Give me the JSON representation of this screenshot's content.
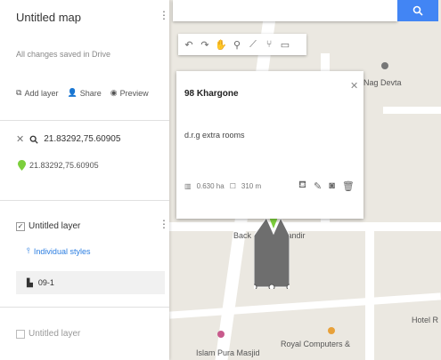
{
  "sidebar": {
    "map_title": "Untitled map",
    "save_status": "All changes saved in Drive",
    "actions": {
      "add_layer": "Add layer",
      "share": "Share",
      "preview": "Preview"
    },
    "search_query": "21.83292,75.60905",
    "location_label": "21.83292,75.60905",
    "layer_name": "Untitled layer",
    "layer_style": "Individual styles",
    "feature_name": "09-1",
    "layer2_name": "Untitled layer"
  },
  "toolbar": {
    "icons": [
      "undo-icon",
      "redo-icon",
      "hand-icon",
      "marker-icon",
      "line-icon",
      "route-icon",
      "ruler-icon"
    ]
  },
  "card": {
    "title": "98 Khargone",
    "description": "d.r.g extra rooms",
    "area": "0.630 ha",
    "perimeter": "310 m"
  },
  "map": {
    "labels": {
      "nag_devta": "Nag Devta",
      "back_mandir": "Back",
      "mandir": "Mandir",
      "hotel": "Hotel R",
      "royal": "Royal Computers &",
      "islam": "Islam Pura Masjid"
    }
  },
  "colors": {
    "accent": "#4285f4",
    "map_bg": "#ebe8e1",
    "polygon_fill": "#6e6e6e",
    "marker_green": "#7ccf3c"
  }
}
